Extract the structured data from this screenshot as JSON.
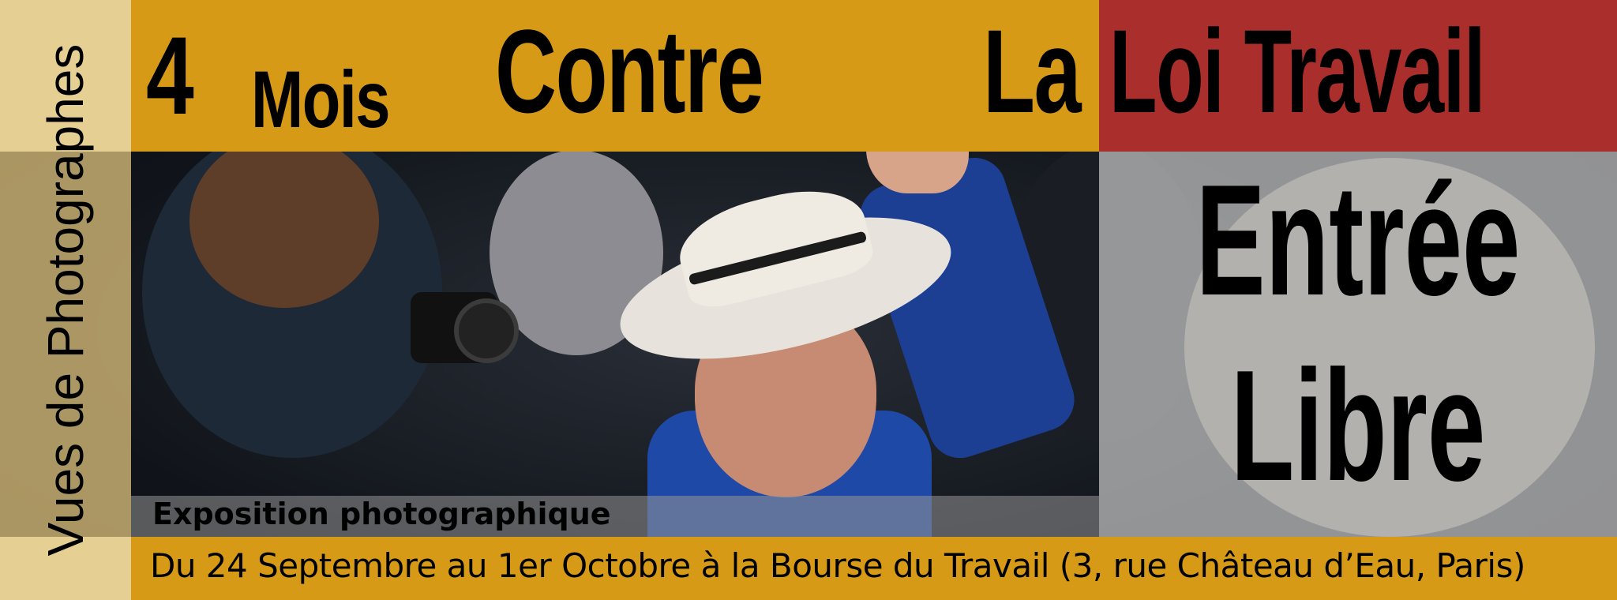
{
  "poster": {
    "side_title": "Vues de Photographes",
    "headline": {
      "part1": "4",
      "part2": "Mois",
      "part3": "Contre",
      "part4": "La",
      "part5": "Loi Travail"
    },
    "entry": {
      "line1": "Entrée",
      "line2": "Libre"
    },
    "exhibition_label": "Exposition photographique",
    "details": "Du 24 Septembre au 1er Octobre à la Bourse du Travail (3, rue Château d’Eau, Paris)"
  },
  "colors": {
    "gold": "#d79a17",
    "red": "#aa2f2c",
    "cream": "#e6cf93",
    "grey_overlay": "#c6c6c6"
  }
}
